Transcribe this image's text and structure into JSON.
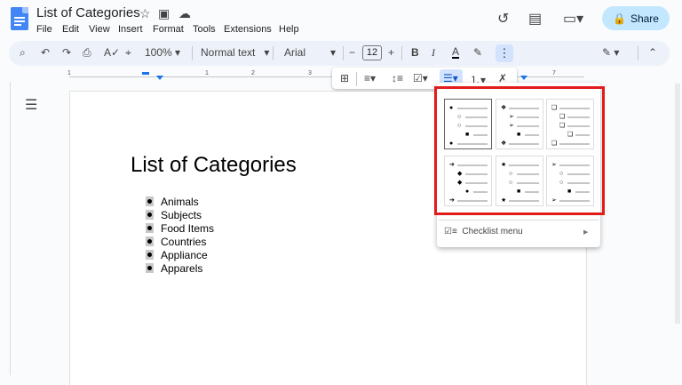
{
  "title": {
    "doc_name": "List of Categories"
  },
  "menu": [
    "File",
    "Edit",
    "View",
    "Insert",
    "Format",
    "Tools",
    "Extensions",
    "Help"
  ],
  "share_label": "Share",
  "toolbar": {
    "zoom": "100%",
    "style": "Normal text",
    "font": "Arial",
    "font_size": "12"
  },
  "ruler_numbers": [
    "1",
    "1",
    "2",
    "3",
    "7"
  ],
  "document": {
    "heading": "List of Categories",
    "list": [
      "Animals",
      "Subjects",
      "Food Items",
      "Countries",
      "Appliance",
      "Apparels"
    ]
  },
  "bullet_menu": {
    "presets": [
      {
        "glyphs": [
          "●",
          "○",
          "○",
          "■",
          "●"
        ]
      },
      {
        "glyphs": [
          "❖",
          "➢",
          "➢",
          "■",
          "❖"
        ]
      },
      {
        "glyphs": [
          "❑",
          "❑",
          "❑",
          "❑",
          "❑"
        ]
      },
      {
        "glyphs": [
          "➔",
          "◆",
          "◆",
          "●",
          "➔"
        ]
      },
      {
        "glyphs": [
          "★",
          "○",
          "○",
          "■",
          "★"
        ]
      },
      {
        "glyphs": [
          "➢",
          "○",
          "○",
          "■",
          "➢"
        ]
      }
    ],
    "checklist_label": "Checklist menu"
  },
  "colors": {
    "accent": "#c2e7ff",
    "highlight": "#e21b1b"
  }
}
